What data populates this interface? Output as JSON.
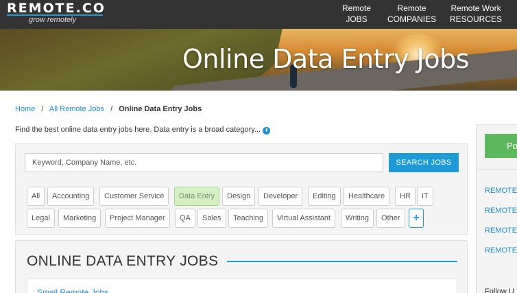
{
  "header": {
    "logo": "REMOTE.CO",
    "tagline": "grow remotely",
    "nav": [
      {
        "line1": "Remote",
        "line2": "JOBS"
      },
      {
        "line1": "Remote",
        "line2": "COMPANIES"
      },
      {
        "line1": "Remote Work",
        "line2": "RESOURCES"
      }
    ]
  },
  "hero": {
    "title": "Online Data Entry Jobs"
  },
  "breadcrumb": {
    "home": "Home",
    "all": "All Remote Jobs",
    "current": "Online Data Entry Jobs",
    "separator": "/"
  },
  "intro": {
    "text": "Find the best online data entry jobs here. Data entry is a broad category...",
    "expand_icon": "plus-circle-icon"
  },
  "search": {
    "placeholder": "Keyword, Company Name, etc.",
    "button_label": "SEARCH JOBS"
  },
  "categories": {
    "row1": [
      "All",
      "Accounting",
      "Customer Service",
      "Data Entry",
      "Design",
      "Developer",
      "Editing",
      "Healthcare",
      "HR",
      "IT"
    ],
    "row2": [
      "Legal",
      "Marketing",
      "Project Manager",
      "QA",
      "Sales",
      "Teaching",
      "Virtual Assistant",
      "Writing",
      "Other"
    ],
    "active": "Data Entry",
    "more_label": "+"
  },
  "jobs": {
    "heading": "ONLINE DATA ENTRY JOBS",
    "first_card_title": "Small Remote Jobs"
  },
  "sidebar": {
    "post_button": "Po",
    "links": [
      "REMOTE",
      "REMOTE",
      "REMOTE",
      "REMOTE"
    ],
    "follow": "Follow U"
  },
  "colors": {
    "accent": "#1d9bd7",
    "header_bg": "#333333",
    "active_chip": "#d6f0c6",
    "post_button": "#5cb85c"
  }
}
